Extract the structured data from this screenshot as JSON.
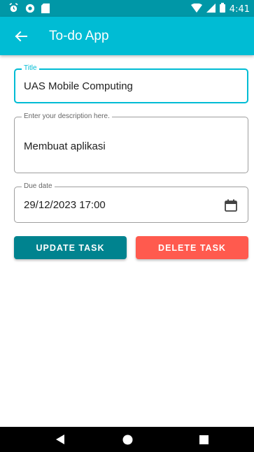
{
  "status_bar": {
    "time": "4:41",
    "left_icons": [
      "alarm-icon",
      "sync-icon",
      "sd-card-icon"
    ],
    "right_icons": [
      "wifi-icon",
      "signal-icon",
      "battery-icon"
    ]
  },
  "app_bar": {
    "title": "To-do App",
    "back_icon": "arrow-left-icon"
  },
  "form": {
    "title_field": {
      "label": "Title",
      "value": "UAS Mobile Computing"
    },
    "description_field": {
      "label": "Enter your description here.",
      "value": "Membuat aplikasi"
    },
    "due_date_field": {
      "label": "Due date",
      "value": "29/12/2023 17:00",
      "icon": "calendar-icon"
    }
  },
  "buttons": {
    "update_label": "UPDATE TASK",
    "delete_label": "DELETE TASK"
  },
  "nav_bar": {
    "icons": [
      "back-triangle-icon",
      "home-circle-icon",
      "recents-square-icon"
    ]
  },
  "colors": {
    "status_bar": "#0097a7",
    "app_bar": "#00bcd4",
    "update_button": "#00838f",
    "delete_button": "#ff5a4e",
    "focused_outline": "#00bcd4"
  }
}
